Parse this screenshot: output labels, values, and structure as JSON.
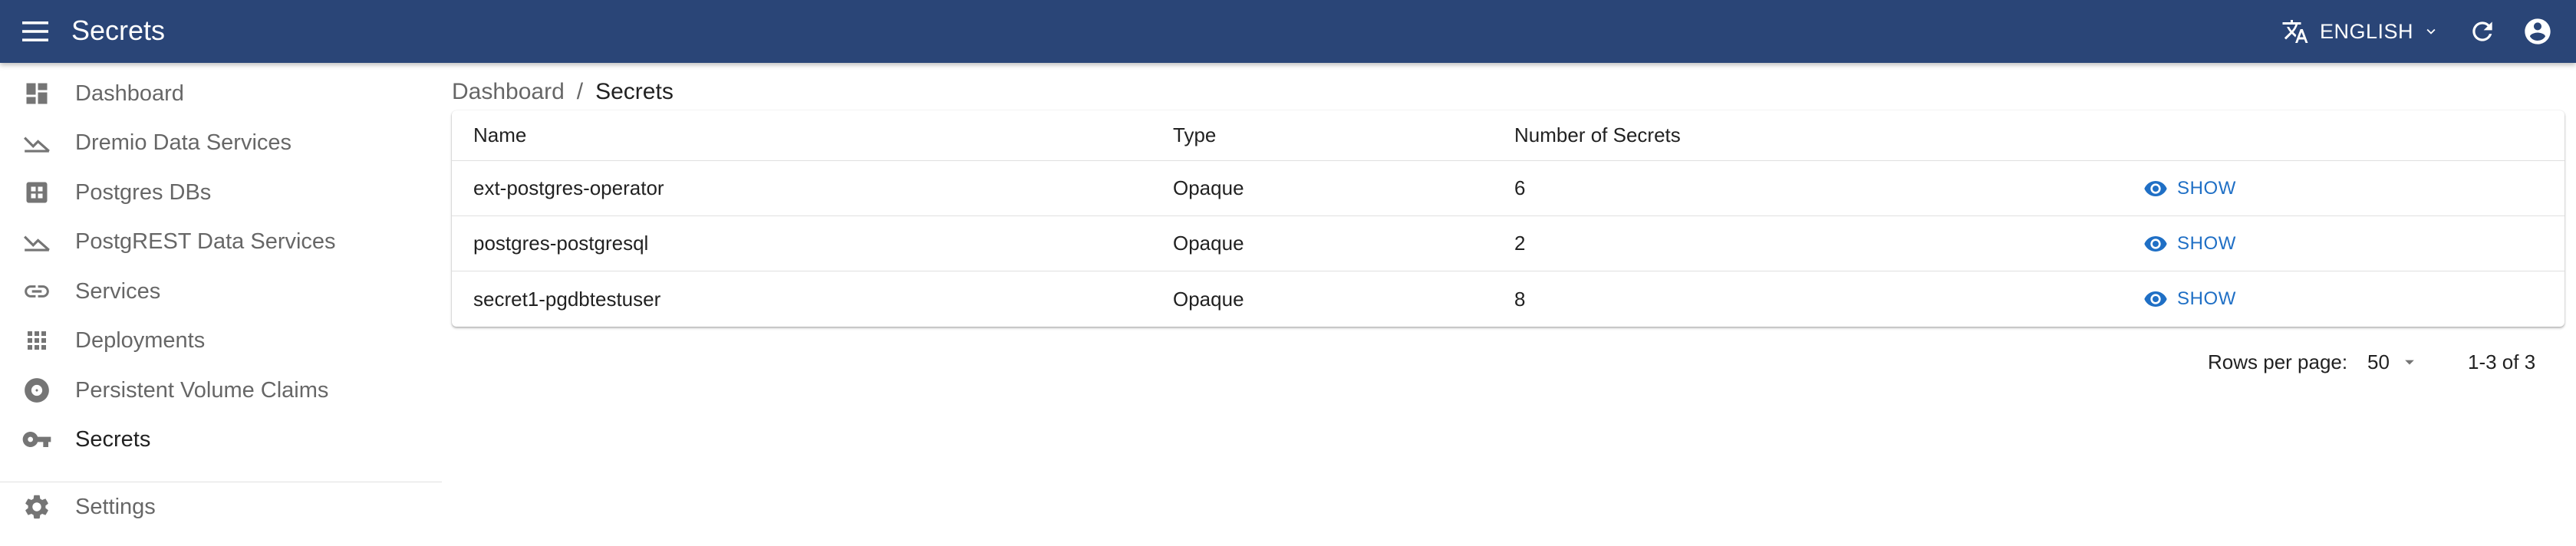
{
  "app": {
    "title": "Secrets",
    "language": "ENGLISH"
  },
  "icons": {
    "menu": "menu-icon",
    "translate": "translate-icon",
    "chevron": "chevron-down-icon",
    "refresh": "refresh-icon",
    "account": "account-circle-icon"
  },
  "sidebar": {
    "items": [
      {
        "label": "Dashboard",
        "icon": "dashboard-icon"
      },
      {
        "label": "Dremio Data Services",
        "icon": "trend-icon"
      },
      {
        "label": "Postgres DBs",
        "icon": "grid-box-icon"
      },
      {
        "label": "PostgREST Data Services",
        "icon": "trend-icon"
      },
      {
        "label": "Services",
        "icon": "link-icon"
      },
      {
        "label": "Deployments",
        "icon": "apps-icon"
      },
      {
        "label": "Persistent Volume Claims",
        "icon": "disc-icon"
      },
      {
        "label": "Secrets",
        "icon": "key-icon"
      },
      {
        "label": "Settings",
        "icon": "gear-icon"
      }
    ]
  },
  "breadcrumb": {
    "root": "Dashboard",
    "separator": "/",
    "current": "Secrets"
  },
  "table": {
    "headers": [
      "Name",
      "Type",
      "Number of Secrets"
    ],
    "action_label": "SHOW",
    "rows": [
      {
        "name": "ext-postgres-operator",
        "type": "Opaque",
        "count": "6"
      },
      {
        "name": "postgres-postgresql",
        "type": "Opaque",
        "count": "2"
      },
      {
        "name": "secret1-pgdbtestuser",
        "type": "Opaque",
        "count": "8"
      }
    ]
  },
  "pagination": {
    "rows_per_page_label": "Rows per page:",
    "rows_per_page_value": "50",
    "range": "1-3 of 3"
  },
  "colors": {
    "appbar": "#2a4577",
    "accent": "#1f6fc5"
  }
}
